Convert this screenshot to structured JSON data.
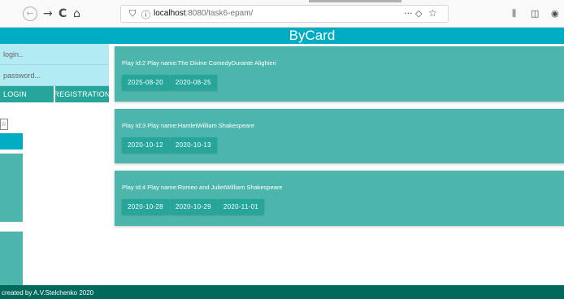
{
  "browser": {
    "back_icon": "back-arrow-icon",
    "forward_glyph": "→",
    "reload_glyph": "C",
    "home_glyph": "⌂",
    "url_host": "localhost",
    "url_rest": ":8080/task6-epam/",
    "menu_glyph": "···",
    "pocket_glyph": "◇",
    "star_glyph": "☆",
    "library_glyph": "⫼",
    "sidebar_glyph": "◫",
    "extra_glyph": "◉"
  },
  "site": {
    "title": "ByCard",
    "accent_color": "#00acc1",
    "card_color": "#4db6ac",
    "chip_color": "#26a69a",
    "footer_color": "#00695c"
  },
  "login": {
    "login_placeholder": "login..",
    "password_placeholder": "password...",
    "login_button": "LOGIN",
    "registration_button": "REGISTRATION"
  },
  "plays": [
    {
      "title": "Play Id:2 Play name:The Divine ComedyDurante Alighieri",
      "dates": [
        "2025-08-20",
        "2020-08-25"
      ]
    },
    {
      "title": "Play Id:3 Play name:HamletWilliam Shakespeare",
      "dates": [
        "2020-10-12",
        "2020-10-13"
      ]
    },
    {
      "title": "Play Id:4 Play name:Romeo and JulietWilliam Shakespeare",
      "dates": [
        "2020-10-28",
        "2020-10-29",
        "2020-11-01"
      ]
    }
  ],
  "ghost_window": {
    "box_glyph": "☆"
  },
  "footer": {
    "text": "created by A.V.Stelchenko 2020"
  }
}
